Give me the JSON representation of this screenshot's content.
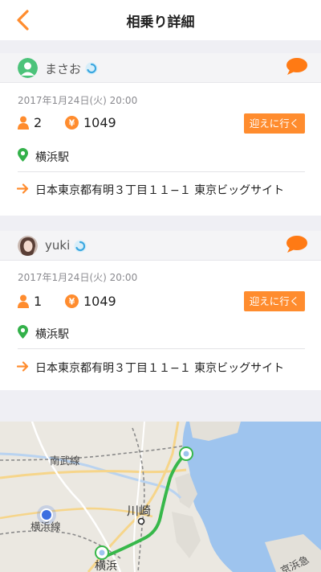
{
  "nav": {
    "title": "相乗り詳細",
    "back_icon": "chevron-left-icon"
  },
  "colors": {
    "accent": "#ff8c2e",
    "pin_green": "#33b14a",
    "route_green": "#37b84a",
    "water": "#9ec4ee"
  },
  "rides": [
    {
      "user": "まさお",
      "avatar": "default-user-avatar",
      "date": "2017年1月24日(火) 20:00",
      "passengers": "2",
      "price": "1049",
      "button": "迎えに行く",
      "origin": "横浜駅",
      "destination": "日本東京都有明３丁目１１−１ 東京ビッグサイト"
    },
    {
      "user": "yuki",
      "avatar": "photo-avatar",
      "date": "2017年1月24日(火) 20:00",
      "passengers": "1",
      "price": "1049",
      "button": "迎えに行く",
      "origin": "横浜駅",
      "destination": "日本東京都有明３丁目１１−１ 東京ビッグサイト"
    }
  ],
  "map": {
    "labels": {
      "line1": "南武線",
      "city": "川崎",
      "line2": "横浜線",
      "station": "横浜",
      "line3": "京浜急"
    }
  }
}
